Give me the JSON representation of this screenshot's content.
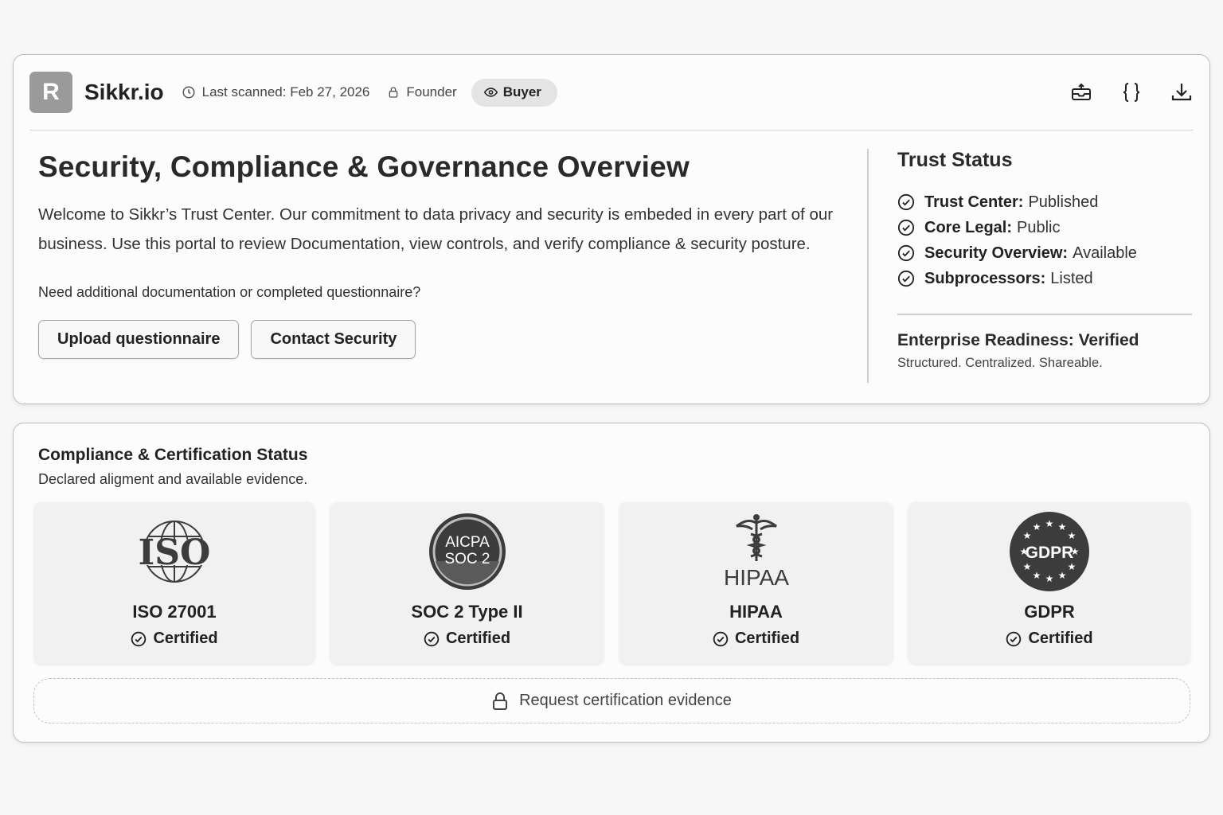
{
  "header": {
    "logo_letter": "R",
    "brand": "Sikkr.io",
    "last_scanned": "Last scanned: Feb 27, 2026",
    "founder_label": "Founder",
    "buyer_label": "Buyer",
    "icons": [
      "inbox-icon",
      "braces-icon",
      "download-icon"
    ]
  },
  "intro": {
    "title": "Security, Compliance & Governance Overview",
    "body": "Welcome to Sikkr’s Trust Center. Our commitment to data privacy and security is embeded in every part of our business. Use this portal to review Documentation, view controls, and verify compliance & security posture.",
    "ask": "Need additional documentation or completed questionnaire?",
    "upload_label": "Upload questionnaire",
    "contact_label": "Contact Security"
  },
  "trust": {
    "title": "Trust Status",
    "items": [
      {
        "key": "Trust Center:",
        "value": "Published"
      },
      {
        "key": "Core Legal:",
        "value": "Public"
      },
      {
        "key": "Security Overview:",
        "value": "Available"
      },
      {
        "key": "Subprocessors:",
        "value": "Listed"
      }
    ],
    "readiness_title": "Enterprise Readiness: Verified",
    "readiness_sub": "Structured. Centralized. Shareable."
  },
  "compliance": {
    "title": "Compliance & Certification Status",
    "subtitle": "Declared aligment and available evidence.",
    "tiles": [
      {
        "logo_text": "ISO",
        "name": "ISO 27001",
        "status": "Certified"
      },
      {
        "logo_text_1": "AICPA",
        "logo_text_2": "SOC 2",
        "name": "SOC 2 Type II",
        "status": "Certified"
      },
      {
        "logo_text": "HIPAA",
        "name": "HIPAA",
        "status": "Certified"
      },
      {
        "logo_text": "GDPR",
        "name": "GDPR",
        "status": "Certified"
      }
    ],
    "request_label": "Request certification evidence"
  },
  "colors": {
    "background": "#f7f7f7",
    "card": "#fcfcfc",
    "logo_box": "#9a9a9a",
    "pill": "#e4e4e4",
    "text": "#222222",
    "badge_dark": "#3c3c3c"
  }
}
